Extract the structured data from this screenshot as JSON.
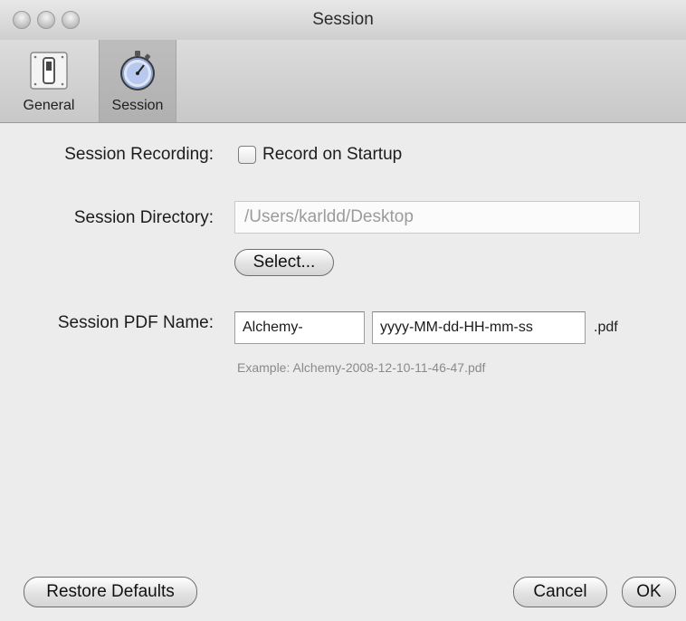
{
  "window": {
    "title": "Session"
  },
  "toolbar": {
    "items": [
      {
        "label": "General",
        "icon": "switch-icon"
      },
      {
        "label": "Session",
        "icon": "stopwatch-icon"
      }
    ],
    "selected": "Session"
  },
  "form": {
    "recording": {
      "label": "Session Recording:",
      "checkbox_label": "Record on Startup",
      "checked": false
    },
    "directory": {
      "label": "Session Directory:",
      "value": "/Users/karldd/Desktop",
      "select_button": "Select..."
    },
    "pdf_name": {
      "label": "Session PDF Name:",
      "prefix_value": "Alchemy-",
      "format_value": "yyyy-MM-dd-HH-mm-ss",
      "suffix": ".pdf",
      "example": "Example: Alchemy-2008-12-10-11-46-47.pdf"
    }
  },
  "footer": {
    "restore": "Restore Defaults",
    "cancel": "Cancel",
    "ok": "OK"
  }
}
